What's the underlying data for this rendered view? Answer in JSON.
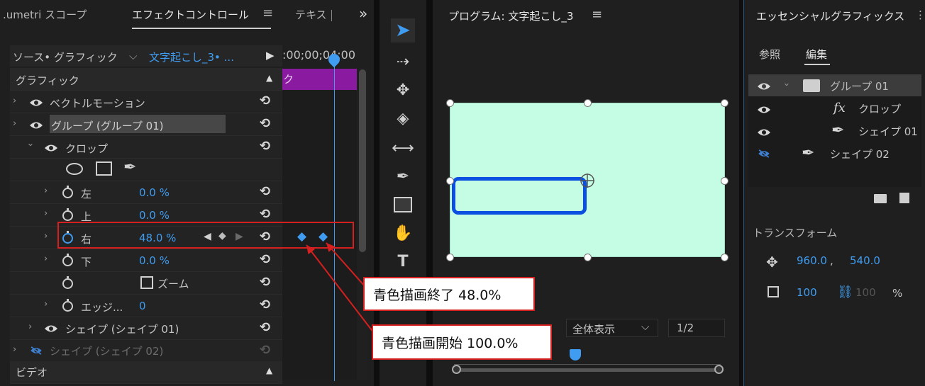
{
  "left_panel": {
    "tabs": [
      ".umetri スコープ",
      "エフェクトコントロール",
      "テキス"
    ],
    "menu_icon": "≡",
    "overflow_icon": "»",
    "source_label": "ソース• グラフィック",
    "clip_label": "文字起こし_3• ...",
    "timecode": ":00;00;04:00",
    "clip_bar_text": "ク",
    "section_graphic": "グラフィック",
    "rows": {
      "vector_motion": "ベクトルモーション",
      "group": "グループ (グループ 01)",
      "crop": "クロップ",
      "left_label": "左",
      "left_value": "0.0 %",
      "top_label": "上",
      "top_value": "0.0 %",
      "right_label": "右",
      "right_value": "48.0 %",
      "bottom_label": "下",
      "bottom_value": "0.0 %",
      "zoom_label": "ズーム",
      "edge_label": "エッジ...",
      "edge_value": "0",
      "shape1": "シェイプ (シェイプ 01)",
      "shape2": "シェイプ (シェイプ 02)"
    },
    "section_video": "ビデオ"
  },
  "program_panel": {
    "title": "プログラム: 文字起こし_3",
    "menu_icon": "≡",
    "zoom_select": "全体表示",
    "resolution": "1/2"
  },
  "essential_graphics": {
    "title": "エッセンシャルグラフィックス",
    "tab_browse": "参照",
    "tab_edit": "編集",
    "layers": {
      "group": "グループ 01",
      "crop": "クロップ",
      "shape1": "シェイプ 01",
      "shape2": "シェイプ 02"
    },
    "fx_icon": "fx",
    "transform_label": "トランスフォーム",
    "pos_x": "960.0",
    "pos_sep": ",",
    "pos_y": "540.0",
    "scale": "100",
    "scale2": "100",
    "percent": "%"
  },
  "callouts": {
    "end": "青色描画終了 48.0%",
    "start": "青色描画開始 100.0%"
  },
  "colors": {
    "accent_blue": "#3f9cf0",
    "callout_red": "#d61f1f",
    "canvas": "#c4fde4",
    "shape_stroke": "#0a4fe0",
    "clip_purple": "#8a1aa0"
  }
}
